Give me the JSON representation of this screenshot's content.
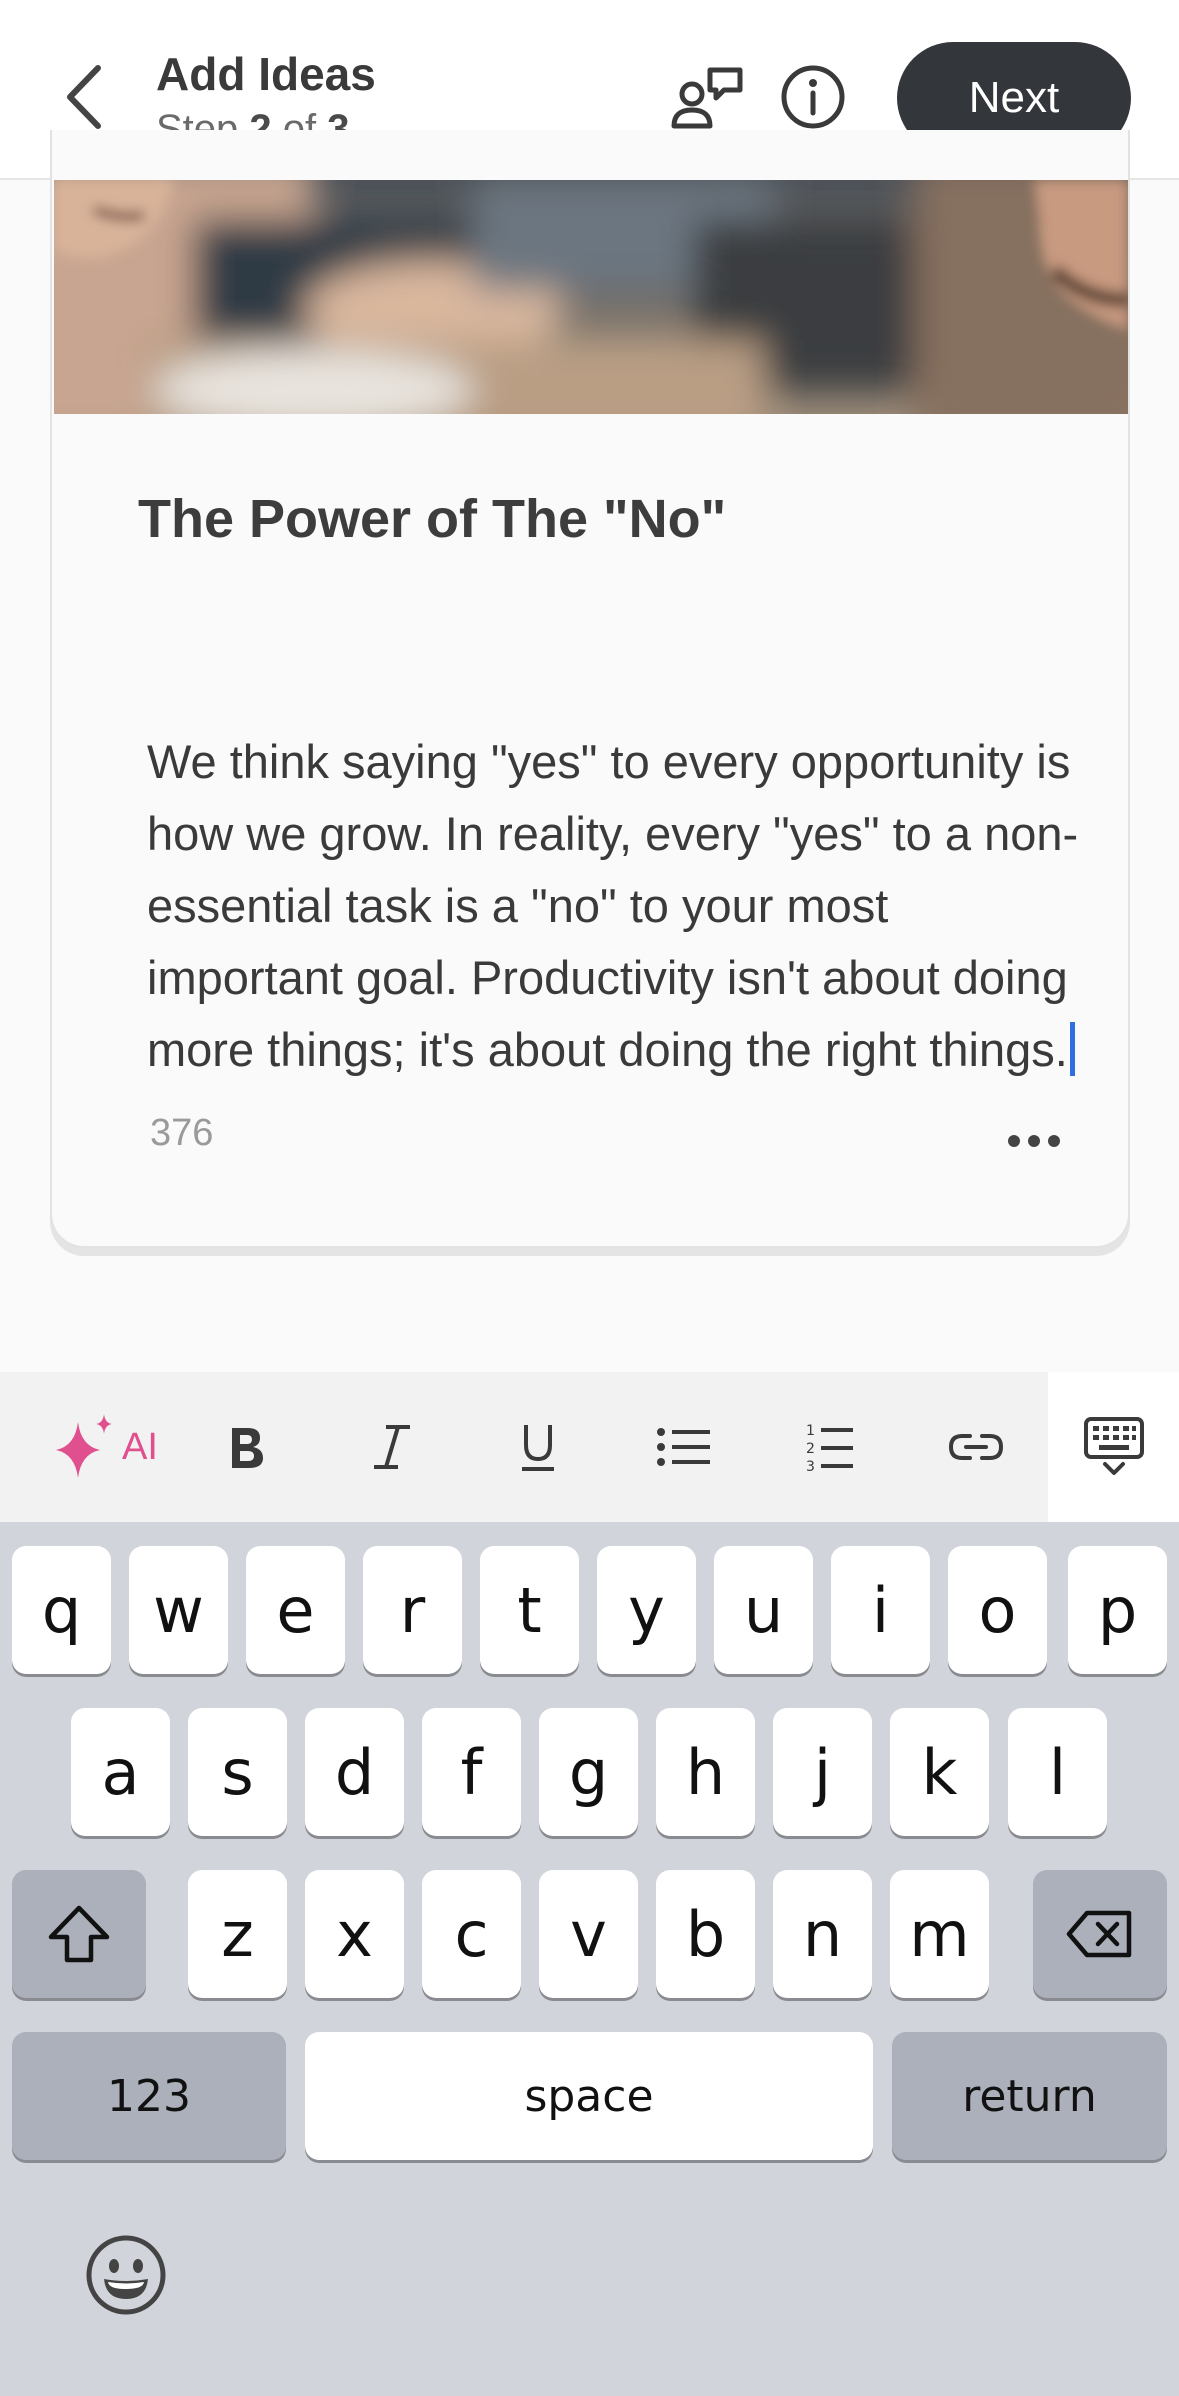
{
  "header": {
    "title": "Add Ideas",
    "step_prefix": "Step ",
    "step_current": "2",
    "step_mid": " of ",
    "step_total": "3",
    "next_label": "Next"
  },
  "card": {
    "title": "The Power of The \"No\"",
    "body": "We think saying \"yes\" to every opportunity is how we grow. In reality, every \"yes\" to a non-essential task is a \"no\" to your most important goal. Productivity isn't about doing more things; it's about doing the right things.",
    "char_count": "376"
  },
  "toolbar": {
    "ai_label": "AI",
    "ai_color": "#e0508f",
    "icons": [
      "sparkle-icon",
      "bold-icon",
      "italic-icon",
      "underline-icon",
      "bullet-list-icon",
      "numbered-list-icon",
      "link-icon",
      "keyboard-dismiss-icon"
    ]
  },
  "keyboard": {
    "row1": [
      "q",
      "w",
      "e",
      "r",
      "t",
      "y",
      "u",
      "i",
      "o",
      "p"
    ],
    "row2": [
      "a",
      "s",
      "d",
      "f",
      "g",
      "h",
      "j",
      "k",
      "l"
    ],
    "row3": [
      "z",
      "x",
      "c",
      "v",
      "b",
      "n",
      "m"
    ],
    "numbers_label": "123",
    "space_label": "space",
    "return_label": "return"
  }
}
